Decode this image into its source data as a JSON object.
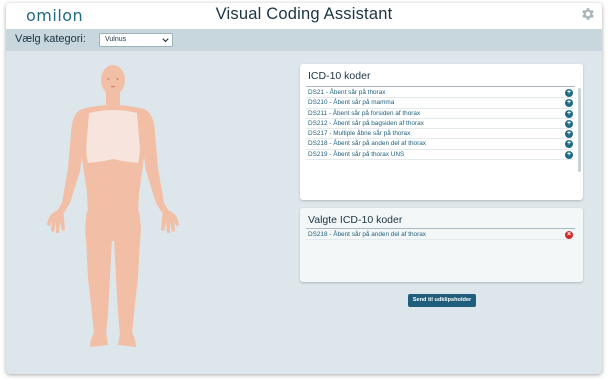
{
  "header": {
    "logo": "omilon",
    "title": "Visual Coding Assistant",
    "settings_icon": "gear-icon"
  },
  "category": {
    "label": "Vælg kategori:",
    "selected": "Vulnus"
  },
  "codes_panel": {
    "title": "ICD-10 koder",
    "items": [
      {
        "label": "DS21 - Åbent sår på thorax"
      },
      {
        "label": "DS210 - Åbent sår på mamma"
      },
      {
        "label": "DS211 - Åbent sår på forsiden af thorax"
      },
      {
        "label": "DS212 - Åbent sår på bagsiden af thorax"
      },
      {
        "label": "DS217 - Multiple åbne sår på thorax"
      },
      {
        "label": "DS218 - Åbent sår på anden del af thorax"
      },
      {
        "label": "DS219 - Åbent sår på thorax UNS"
      }
    ]
  },
  "selected_panel": {
    "title": "Valgte ICD-10 koder",
    "items": [
      {
        "label": "DS218 - Åbent sår på anden del af thorax"
      }
    ]
  },
  "send_button": "Send til udklipsholder",
  "colors": {
    "accent": "#1f6b86",
    "background": "#dde6ea",
    "skin": "#f2bfa6",
    "highlight": "#f7e4dc",
    "remove": "#d02a2a"
  }
}
